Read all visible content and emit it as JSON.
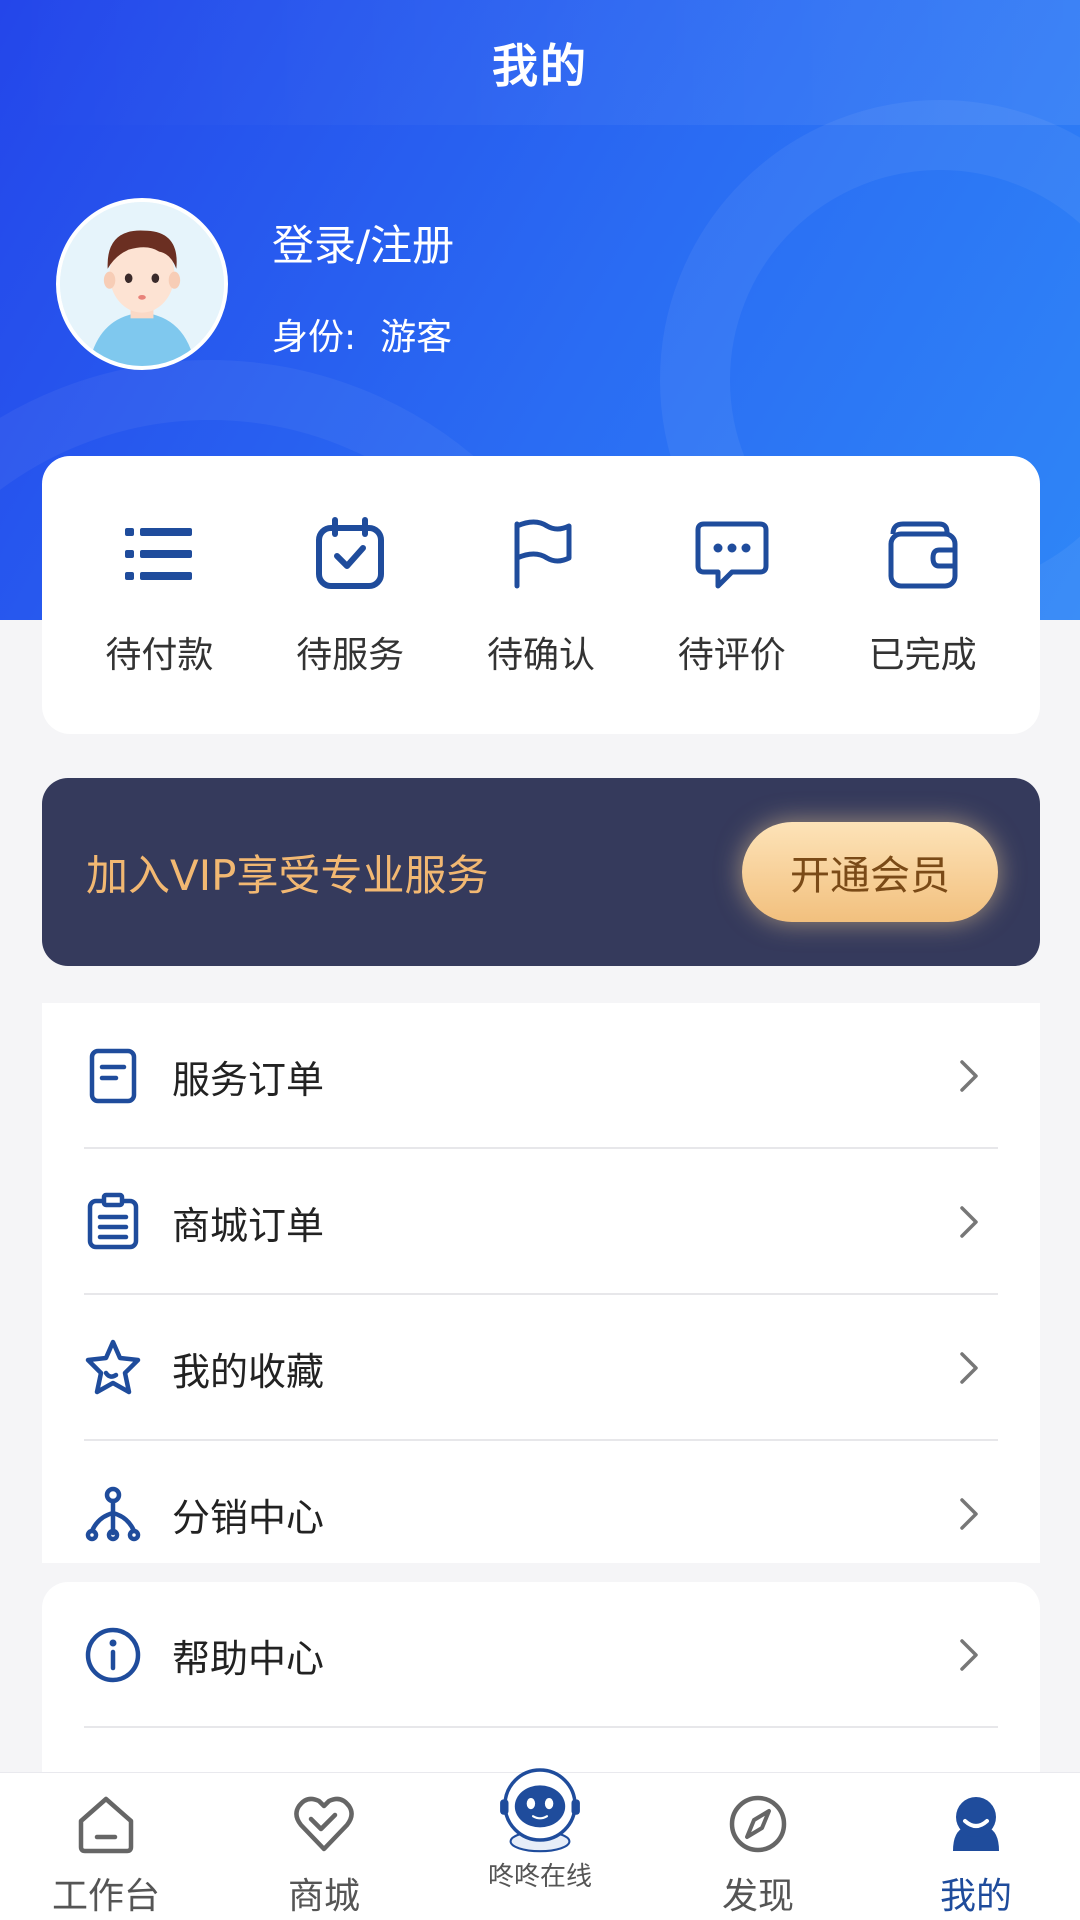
{
  "header": {
    "title": "我的"
  },
  "profile": {
    "name": "登录/注册",
    "role_label": "身份:",
    "role_value": "游客"
  },
  "order_status": [
    {
      "label": "待付款",
      "icon": "list-icon"
    },
    {
      "label": "待服务",
      "icon": "calendar-check-icon"
    },
    {
      "label": "待确认",
      "icon": "flag-icon"
    },
    {
      "label": "待评价",
      "icon": "chat-bubble-icon"
    },
    {
      "label": "已完成",
      "icon": "wallet-icon"
    }
  ],
  "vip": {
    "text": "加入VIP享受专业服务",
    "button": "开通会员"
  },
  "menu_main": [
    {
      "label": "服务订单",
      "icon": "document-icon"
    },
    {
      "label": "商城订单",
      "icon": "clipboard-icon"
    },
    {
      "label": "我的收藏",
      "icon": "star-icon"
    },
    {
      "label": "分销中心",
      "icon": "network-icon"
    }
  ],
  "menu_more": [
    {
      "label": "帮助中心",
      "icon": "info-icon"
    }
  ],
  "tabbar": [
    {
      "label": "工作台",
      "icon": "home-icon"
    },
    {
      "label": "商城",
      "icon": "heart-icon"
    },
    {
      "label": "咚咚在线",
      "icon": "robot-icon"
    },
    {
      "label": "发现",
      "icon": "compass-icon"
    },
    {
      "label": "我的",
      "icon": "user-icon",
      "active": true
    }
  ],
  "colors": {
    "accent_blue": "#1f4c9c",
    "header_gradient_start": "#2446ea",
    "header_gradient_end": "#2f86f7",
    "vip_bg": "#353a5c",
    "vip_text": "#f2b872"
  }
}
